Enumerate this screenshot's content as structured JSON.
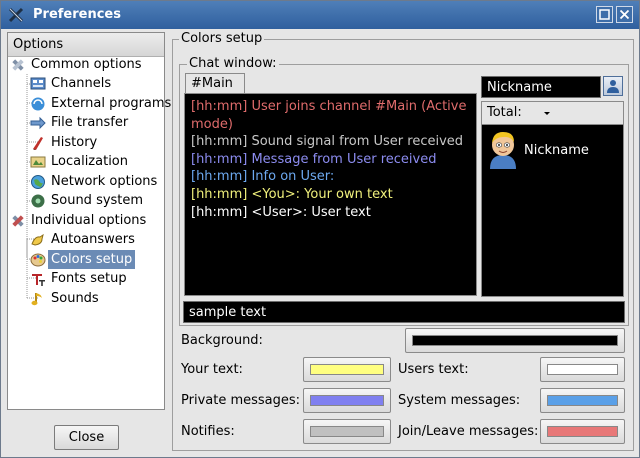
{
  "window": {
    "title": "Preferences"
  },
  "sidebar": {
    "header": "Options",
    "items": [
      {
        "label": "Common options",
        "icon": "tools-icon"
      },
      {
        "label": "Channels",
        "icon": "channels-icon"
      },
      {
        "label": "External programs",
        "icon": "external-programs-icon"
      },
      {
        "label": "File transfer",
        "icon": "file-transfer-icon"
      },
      {
        "label": "History",
        "icon": "history-icon"
      },
      {
        "label": "Localization",
        "icon": "localization-icon"
      },
      {
        "label": "Network options",
        "icon": "network-icon"
      },
      {
        "label": "Sound system",
        "icon": "sound-icon"
      },
      {
        "label": "Individual options",
        "icon": "tools-icon"
      },
      {
        "label": "Autoanswers",
        "icon": "autoanswers-icon"
      },
      {
        "label": "Colors setup",
        "icon": "palette-icon",
        "selected": true
      },
      {
        "label": "Fonts setup",
        "icon": "fonts-icon"
      },
      {
        "label": "Sounds",
        "icon": "music-note-icon"
      }
    ],
    "close_label": "Close"
  },
  "colors_setup": {
    "group_title": "Colors setup",
    "chat_group_title": "Chat window:",
    "tab_label": "#Main",
    "chat_lines": [
      {
        "text": "[hh:mm] User joins channel #Main (Active mode)",
        "color": "#e06c6c"
      },
      {
        "text": "[hh:mm] Sound signal from User received",
        "color": "#c8c8c8"
      },
      {
        "text": "[hh:mm] Message from User received",
        "color": "#8c8cf0"
      },
      {
        "text": "[hh:mm] Info on User:",
        "color": "#6da9f0"
      },
      {
        "text": "[hh:mm] <You>: Your own text",
        "color": "#f0f07c"
      },
      {
        "text": "[hh:mm] <User>: User text",
        "color": "#ffffff"
      }
    ],
    "nickname_field": "Nickname",
    "userlist_header": "Total:",
    "user_nickname": "Nickname",
    "sample_text": "sample text",
    "background_label": "Background:",
    "your_text_label": "Your text:",
    "users_text_label": "Users text:",
    "private_messages_label": "Private messages:",
    "system_messages_label": "System messages:",
    "notifies_label": "Notifies:",
    "join_leave_label": "Join/Leave messages:",
    "colors": {
      "background": "#000000",
      "your_text": "#ffff80",
      "users_text": "#ffffff",
      "private_messages": "#8080f0",
      "system_messages": "#5aa0e8",
      "notifies": "#c0c0c0",
      "join_leave": "#e87878"
    }
  }
}
